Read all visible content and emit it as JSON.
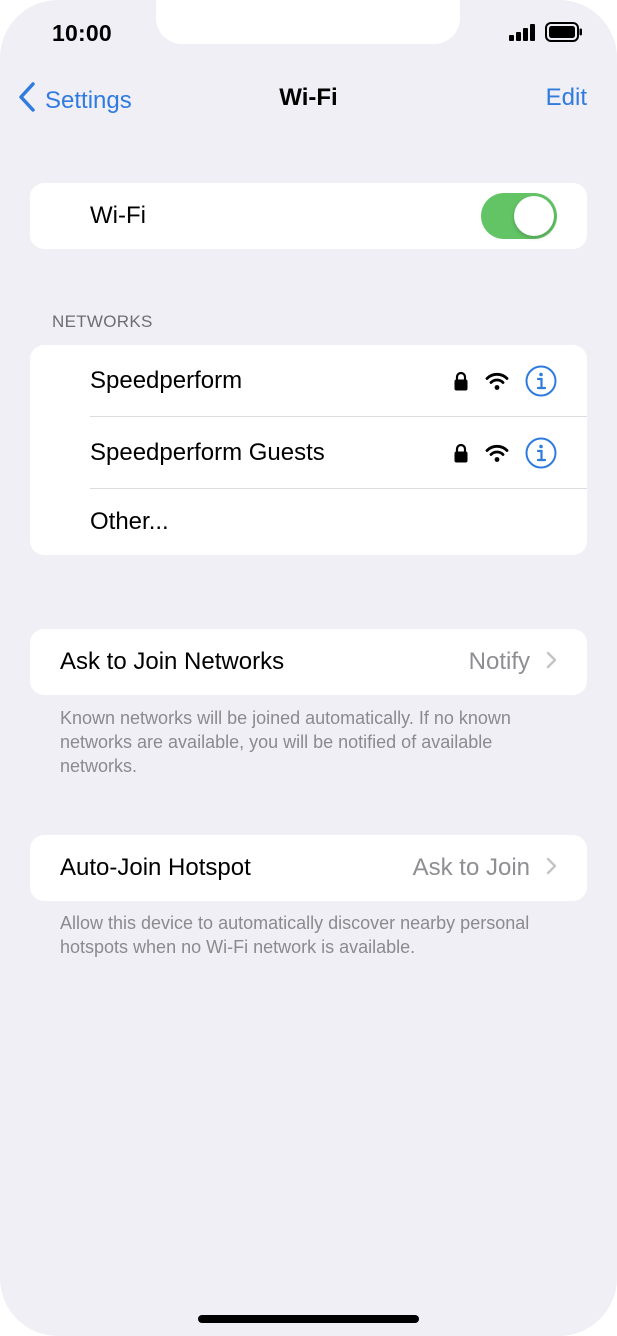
{
  "status_bar": {
    "time": "10:00"
  },
  "nav": {
    "back_label": "Settings",
    "title": "Wi-Fi",
    "edit_label": "Edit"
  },
  "wifi_toggle": {
    "label": "Wi-Fi",
    "on": true,
    "accent": "#63c466"
  },
  "networks": {
    "header": "NETWORKS",
    "items": [
      {
        "name": "Speedperform",
        "secured": true
      },
      {
        "name": "Speedperform Guests",
        "secured": true
      }
    ],
    "other_label": "Other..."
  },
  "ask_to_join": {
    "label": "Ask to Join Networks",
    "value": "Notify",
    "note": "Known networks will be joined automatically. If no known networks are available, you will be notified of available networks."
  },
  "auto_join_hotspot": {
    "label": "Auto-Join Hotspot",
    "value": "Ask to Join",
    "note": "Allow this device to automatically discover nearby personal hotspots when no Wi-Fi network is available."
  },
  "colors": {
    "link": "#2f7be0",
    "background": "#f0eff5",
    "secondary_text": "#8e8e93"
  }
}
